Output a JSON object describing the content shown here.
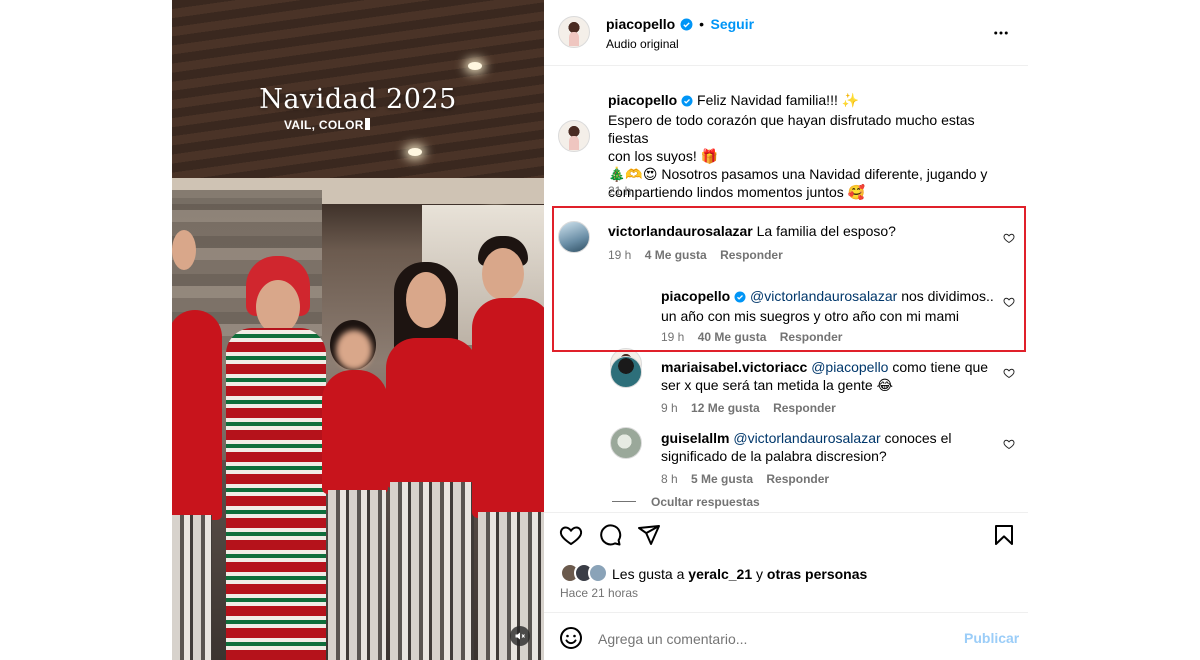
{
  "media": {
    "title": "Navidad 2025",
    "subtitle": "VAIL, COLOR",
    "mute_icon": "muted-speaker-icon"
  },
  "header": {
    "username": "piacopello",
    "separator": "•",
    "follow_label": "Seguir",
    "audio_label": "Audio original",
    "more_icon": "more-dots-icon"
  },
  "caption": {
    "username": "piacopello",
    "line1": "Feliz Navidad familia!!! ✨",
    "line2": "Espero de todo corazón que hayan disfrutado mucho estas fiestas",
    "line3": "con los suyos! 🎁",
    "line4": "🎄🫶😍 Nosotros pasamos una Navidad diferente, jugando y",
    "line5": "compartiendo lindos momentos juntos 🥰",
    "time": "21 h"
  },
  "comments": [
    {
      "username": "victorlandaurosalazar",
      "text": "La familia del esposo?",
      "time": "19 h",
      "likes": "4 Me gusta",
      "reply": "Responder"
    }
  ],
  "replies": [
    {
      "username": "piacopello",
      "mention": "@victorlandaurosalazar",
      "line1": "nos dividimos..",
      "line2": "un año con mis suegros y otro año con mi mami",
      "time": "19 h",
      "likes": "40 Me gusta",
      "reply": "Responder"
    },
    {
      "username": "mariaisabel.victoriacc",
      "mention": "@piacopello",
      "line1": "como tiene que",
      "line2": "ser x que será tan metida la gente 😂",
      "time": "9 h",
      "likes": "12 Me gusta",
      "reply": "Responder"
    },
    {
      "username": "guiselallm",
      "mention": "@victorlandaurosalazar",
      "line1": "conoces el",
      "line2": "significado de la palabra discresion?",
      "time": "8 h",
      "likes": "5 Me gusta",
      "reply": "Responder"
    }
  ],
  "hide_replies": "Ocultar respuestas",
  "likes_summary": {
    "prefix": "Les gusta a",
    "user": "yeralc_21",
    "conj": "y",
    "others": "otras personas",
    "time_ago": "Hace 21 horas"
  },
  "composer": {
    "placeholder": "Agrega un comentario...",
    "publish_label": "Publicar",
    "emoji_icon": "emoji-icon"
  },
  "colors": {
    "link": "#0095f6",
    "highlight_border": "#e0202a",
    "shirt_red": "#c8141c"
  }
}
